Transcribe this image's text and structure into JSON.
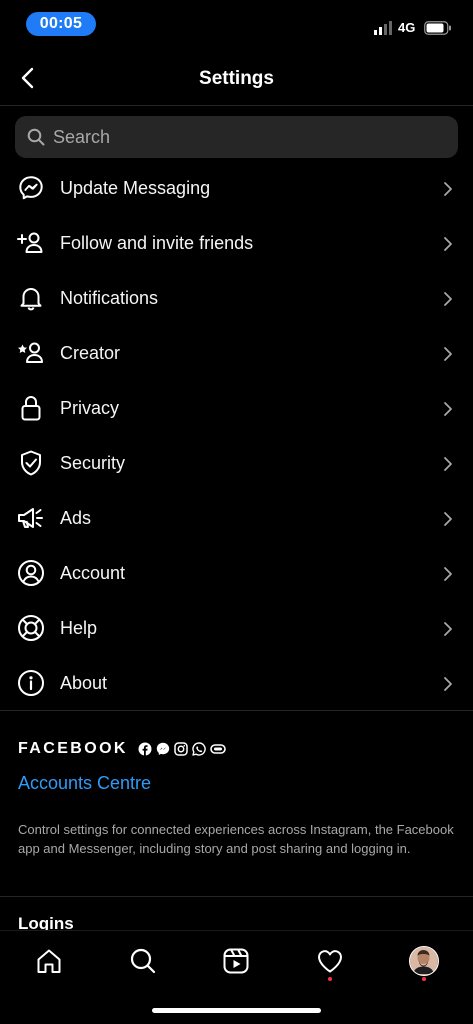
{
  "status_bar": {
    "time": "00:05",
    "network": "4G"
  },
  "header": {
    "title": "Settings"
  },
  "search": {
    "placeholder": "Search"
  },
  "menu": [
    {
      "label": "Update Messaging",
      "icon": "messenger-icon"
    },
    {
      "label": "Follow and invite friends",
      "icon": "add-person-icon"
    },
    {
      "label": "Notifications",
      "icon": "bell-icon"
    },
    {
      "label": "Creator",
      "icon": "star-person-icon"
    },
    {
      "label": "Privacy",
      "icon": "lock-icon"
    },
    {
      "label": "Security",
      "icon": "shield-check-icon"
    },
    {
      "label": "Ads",
      "icon": "megaphone-icon"
    },
    {
      "label": "Account",
      "icon": "account-circle-icon"
    },
    {
      "label": "Help",
      "icon": "lifebuoy-icon"
    },
    {
      "label": "About",
      "icon": "info-icon"
    }
  ],
  "accounts_centre": {
    "brand": "FACEBOOK",
    "link": "Accounts Centre",
    "description": "Control settings for connected experiences across Instagram, the Facebook app and Messenger, including story and post sharing and logging in."
  },
  "logins": {
    "heading": "Logins"
  },
  "tab_bar": {
    "tabs": [
      "home-icon",
      "search-icon",
      "reels-icon",
      "heart-icon",
      "profile-avatar"
    ]
  },
  "colors": {
    "accent_link": "#2f9bf7",
    "time_pill": "#1f7cf6",
    "notification_dot": "#ff3040"
  }
}
